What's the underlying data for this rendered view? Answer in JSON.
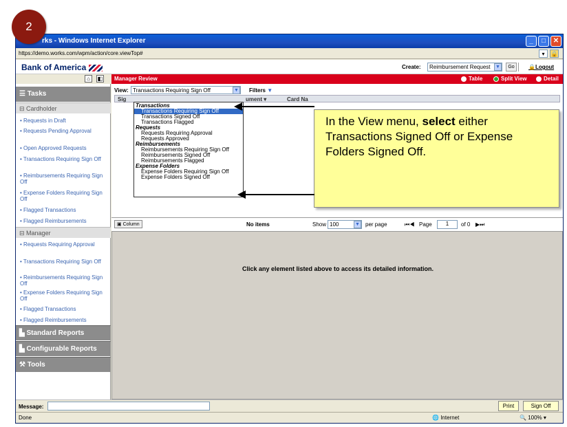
{
  "step_badge": "2",
  "window": {
    "title": "rks - Windows Internet Explorer",
    "url": "https://demo.works.com/wpm/action/core.viewTop#"
  },
  "header": {
    "brand": "Bank of America",
    "create_label": "Create:",
    "create_value": "Reimbursement Request",
    "go_label": "Go",
    "logout_label": "Logout"
  },
  "sidebar": {
    "tasks_label": "Tasks",
    "cardholder_label": "Cardholder",
    "cardholder_items": [
      "Requests in Draft",
      "Requests Pending Approval",
      "Open Approved Requests",
      "Transactions Requiring Sign Off",
      "Reimbursements Requiring Sign Off",
      "Expense Folders Requiring Sign Off",
      "Flagged Transactions",
      "Flagged Reimbursements"
    ],
    "manager_label": "Manager",
    "manager_items": [
      "Requests Requiring Approval",
      "Transactions Requiring Sign Off",
      "Reimbursements Requiring Sign Off",
      "Expense Folders Requiring Sign Off",
      "Flagged Transactions",
      "Flagged Reimbursements"
    ],
    "sections": [
      "Standard Reports",
      "Configurable Reports",
      "Tools"
    ]
  },
  "main": {
    "title": "Manager Review",
    "view_modes": [
      "Table",
      "Split View",
      "Detail"
    ],
    "active_view_mode": "Split View",
    "view_label": "View:",
    "view_value": "Transactions Requiring Sign Off",
    "filters_label": "Filters",
    "grid_columns": [
      "Sig",
      "ument",
      "Card Na"
    ],
    "menu": [
      {
        "group": "Transactions",
        "items": [
          "Transactions Requiring Sign Off",
          "Transactions Signed Off",
          "Transactions Flagged"
        ]
      },
      {
        "group": "Requests",
        "items": [
          "Requests Requiring Approval",
          "Requests Approved"
        ]
      },
      {
        "group": "Reimbursements",
        "items": [
          "Reimbursements Requiring Sign Off",
          "Reimbursements Signed Off",
          "Reimbursements Flagged"
        ]
      },
      {
        "group": "Expense Folders",
        "items": [
          "Expense Folders Requiring Sign Off",
          "Expense Folders Signed Off"
        ]
      }
    ],
    "selected_menu_item": "Transactions Requiring Sign Off"
  },
  "callout": {
    "pre": "In the View menu, ",
    "bold": "select",
    "post": " either Transactions Signed Off or Expense Folders Signed Off."
  },
  "pager": {
    "column_label": "Column",
    "no_items": "No items",
    "show_label": "Show",
    "per_page_value": "100",
    "per_page_label": "per page",
    "page_label": "Page",
    "page_value": "1",
    "of_label": "of 0"
  },
  "detail_message": "Click any element listed above to access its detailed information.",
  "bottom": {
    "message_label": "Message:",
    "print_label": "Print",
    "signoff_label": "Sign Off"
  },
  "status": {
    "left": "Done",
    "zone": "Internet",
    "zoom": "100%"
  },
  "colors": {
    "brand_red": "#d9001b",
    "callout_bg": "#ffff99",
    "link": "#3a64b0"
  }
}
